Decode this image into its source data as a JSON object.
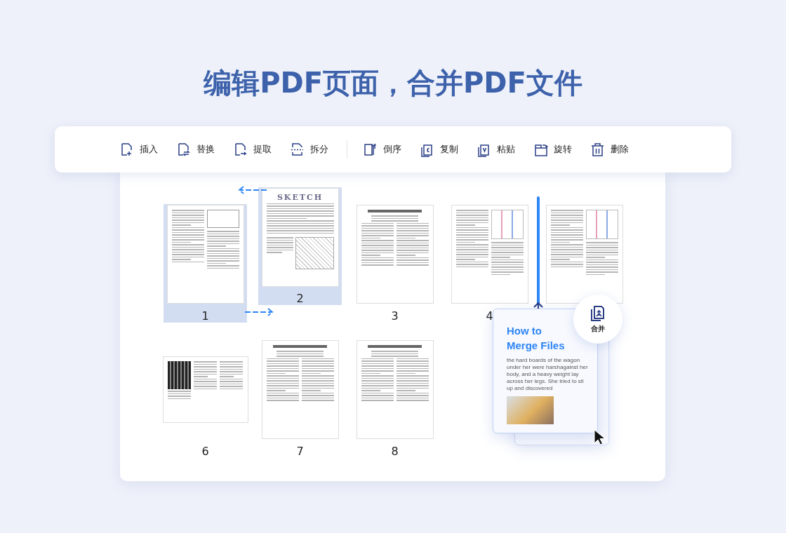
{
  "title": "编辑PDF页面，合并PDF文件",
  "toolbar": {
    "groups": [
      [
        {
          "label": "插入",
          "kind": "insert"
        },
        {
          "label": "替换",
          "kind": "replace"
        },
        {
          "label": "提取",
          "kind": "extract"
        },
        {
          "label": "拆分",
          "kind": "split"
        }
      ],
      [
        {
          "label": "倒序",
          "kind": "reverse"
        },
        {
          "label": "复制",
          "kind": "copy"
        },
        {
          "label": "粘贴",
          "kind": "paste"
        },
        {
          "label": "旋转",
          "kind": "rotate"
        },
        {
          "label": "删除",
          "kind": "delete"
        }
      ]
    ]
  },
  "pages": [
    {
      "number": "1",
      "selected": true,
      "kind": "text"
    },
    {
      "number": "2",
      "selected": true,
      "kind": "sketch",
      "heading": "SKETCH"
    },
    {
      "number": "3",
      "selected": false,
      "kind": "paper"
    },
    {
      "number": "4",
      "selected": false,
      "kind": "figure"
    },
    {
      "selected": false,
      "kind": "figure"
    },
    {
      "number": "6",
      "selected": false,
      "kind": "landscape"
    },
    {
      "number": "7",
      "selected": false,
      "kind": "paper"
    },
    {
      "number": "8",
      "selected": false,
      "kind": "paper"
    }
  ],
  "merge": {
    "button_label": "合并",
    "card_title": "How to Merge Files",
    "card_text": "the hard boards of the wagon under her were harshagainst her body, and a heavy weight lay across her legs. She tried to sit up and discovered"
  }
}
